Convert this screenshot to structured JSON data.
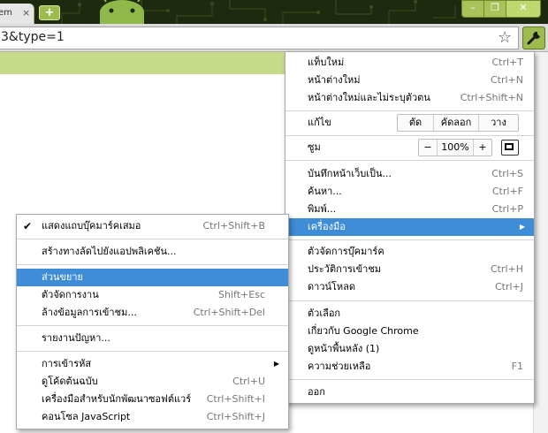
{
  "tab": {
    "title": "em",
    "close_icon": "×"
  },
  "newtab_icon": "+",
  "window": {
    "min": "–",
    "max": "❐",
    "close": "✕"
  },
  "omnibox": {
    "url": "3&type=1"
  },
  "icons": {
    "star": "☆",
    "wrench": "wrench-icon"
  },
  "colors": {
    "accent": "#9dbb4f",
    "highlight": "#3f8dd6",
    "titlebar": "#1e2a10",
    "greenbar": "#c6dc88"
  },
  "main_menu": {
    "new_tab": {
      "label": "แท็บใหม่",
      "shortcut": "Ctrl+T"
    },
    "new_window": {
      "label": "หน้าต่างใหม่",
      "shortcut": "Ctrl+N"
    },
    "incognito": {
      "label": "หน้าต่างใหม่และไม่ระบุตัวตน",
      "shortcut": "Ctrl+Shift+N"
    },
    "edit": {
      "label": "แก้ไข",
      "cut": "ตัด",
      "copy": "คัดลอก",
      "paste": "วาง"
    },
    "zoom": {
      "label": "ซูม",
      "minus": "−",
      "value": "100%",
      "plus": "+"
    },
    "save": {
      "label": "บันทึกหน้าเว็บเป็น...",
      "shortcut": "Ctrl+S"
    },
    "find": {
      "label": "ค้นหา...",
      "shortcut": "Ctrl+F"
    },
    "print": {
      "label": "พิมพ์...",
      "shortcut": "Ctrl+P"
    },
    "tools": {
      "label": "เครื่องมือ",
      "arrow": "▶"
    },
    "bookmarks": {
      "label": "ตัวจัดการบุ๊คมาร์ค"
    },
    "history": {
      "label": "ประวัติการเข้าชม",
      "shortcut": "Ctrl+H"
    },
    "downloads": {
      "label": "ดาวน์โหลด",
      "shortcut": "Ctrl+J"
    },
    "options": {
      "label": "ตัวเลือก"
    },
    "about": {
      "label": "เกี่ยวกับ Google Chrome"
    },
    "background": {
      "label": "ดูหน้าพื้นหลัง (1)"
    },
    "help": {
      "label": "ความช่วยเหลือ",
      "shortcut": "F1"
    },
    "exit": {
      "label": "ออก"
    }
  },
  "tools_menu": {
    "show_bookmarks": {
      "check": "✔",
      "label": "แสดงแถบบุ๊คมาร์คเสมอ",
      "shortcut": "Ctrl+Shift+B"
    },
    "app_shortcuts": {
      "label": "สร้างทางลัดไปยังแอปพลิเคชัน..."
    },
    "extensions": {
      "label": "ส่วนขยาย"
    },
    "task_manager": {
      "label": "ตัวจัดการงาน",
      "shortcut": "Shift+Esc"
    },
    "clear_data": {
      "label": "ล้างข้อมูลการเข้าชม...",
      "shortcut": "Ctrl+Shift+Del"
    },
    "report": {
      "label": "รายงานปัญหา..."
    },
    "encoding": {
      "label": "การเข้ารหัส",
      "arrow": "▶"
    },
    "view_source": {
      "label": "ดูโค้ดต้นฉบับ",
      "shortcut": "Ctrl+U"
    },
    "dev_tools": {
      "label": "เครื่องมือสำหรับนักพัฒนาซอฟต์แวร์",
      "shortcut": "Ctrl+Shift+I"
    },
    "js_console": {
      "label": "คอนโซล JavaScript",
      "shortcut": "Ctrl+Shift+J"
    }
  }
}
